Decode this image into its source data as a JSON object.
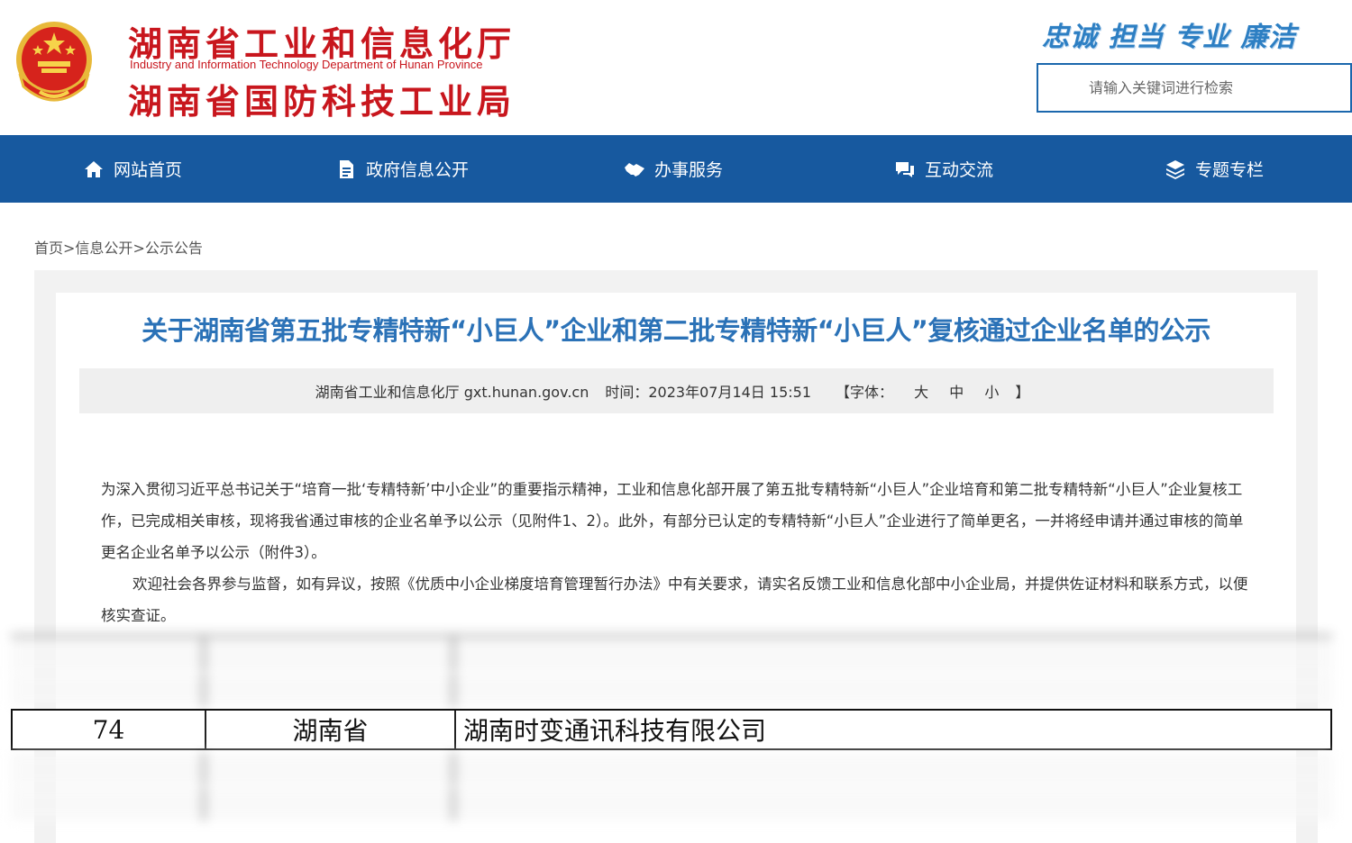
{
  "header": {
    "logo_line1": "湖南省工业和信息化厅",
    "logo_en": "Industry and Information Technology Department of Hunan Province",
    "logo_line2": "湖南省国防科技工业局",
    "slogan": "忠诚 担当 专业 廉洁",
    "search_placeholder": "请输入关键词进行检索"
  },
  "nav": {
    "items": [
      {
        "label": "网站首页",
        "icon": "home-icon"
      },
      {
        "label": "政府信息公开",
        "icon": "document-icon"
      },
      {
        "label": "办事服务",
        "icon": "handshake-icon"
      },
      {
        "label": "互动交流",
        "icon": "chat-icon"
      },
      {
        "label": "专题专栏",
        "icon": "layers-icon"
      }
    ]
  },
  "breadcrumb": {
    "home": "首页",
    "sep": ">",
    "level1": "信息公开",
    "level2": "公示公告"
  },
  "article": {
    "title": "关于湖南省第五批专精特新“小巨人”企业和第二批专精特新“小巨人”复核通过企业名单的公示",
    "source": "湖南省工业和信息化厅 gxt.hunan.gov.cn",
    "time": "时间：2023年07月14日 15:51",
    "font_prefix": "【字体：",
    "font_large": "大",
    "font_medium": "中",
    "font_small": "小",
    "font_suffix": "】",
    "para1": "为深入贯彻习近平总书记关于“培育一批‘专精特新’中小企业”的重要指示精神，工业和信息化部开展了第五批专精特新“小巨人”企业培育和第二批专精特新“小巨人”企业复核工作，已完成相关审核，现将我省通过审核的企业名单予以公示（见附件1、2）。此外，有部分已认定的专精特新“小巨人”企业进行了简单更名，一并将经申请并通过审核的简单更名企业名单予以公示（附件3）。",
    "para2": "欢迎社会各界参与监督，如有异议，按照《优质中小企业梯度培育管理暂行办法》中有关要求，请实名反馈工业和信息化部中小企业局，并提供佐证材料和联系方式，以便核实查证。"
  },
  "table": {
    "highlight_row": {
      "no": "74",
      "province": "湖南省",
      "company": "湖南时变通讯科技有限公司"
    }
  },
  "colors": {
    "brand_red": "#c8161d",
    "nav_blue": "#17599f",
    "title_blue": "#2b72b7"
  }
}
